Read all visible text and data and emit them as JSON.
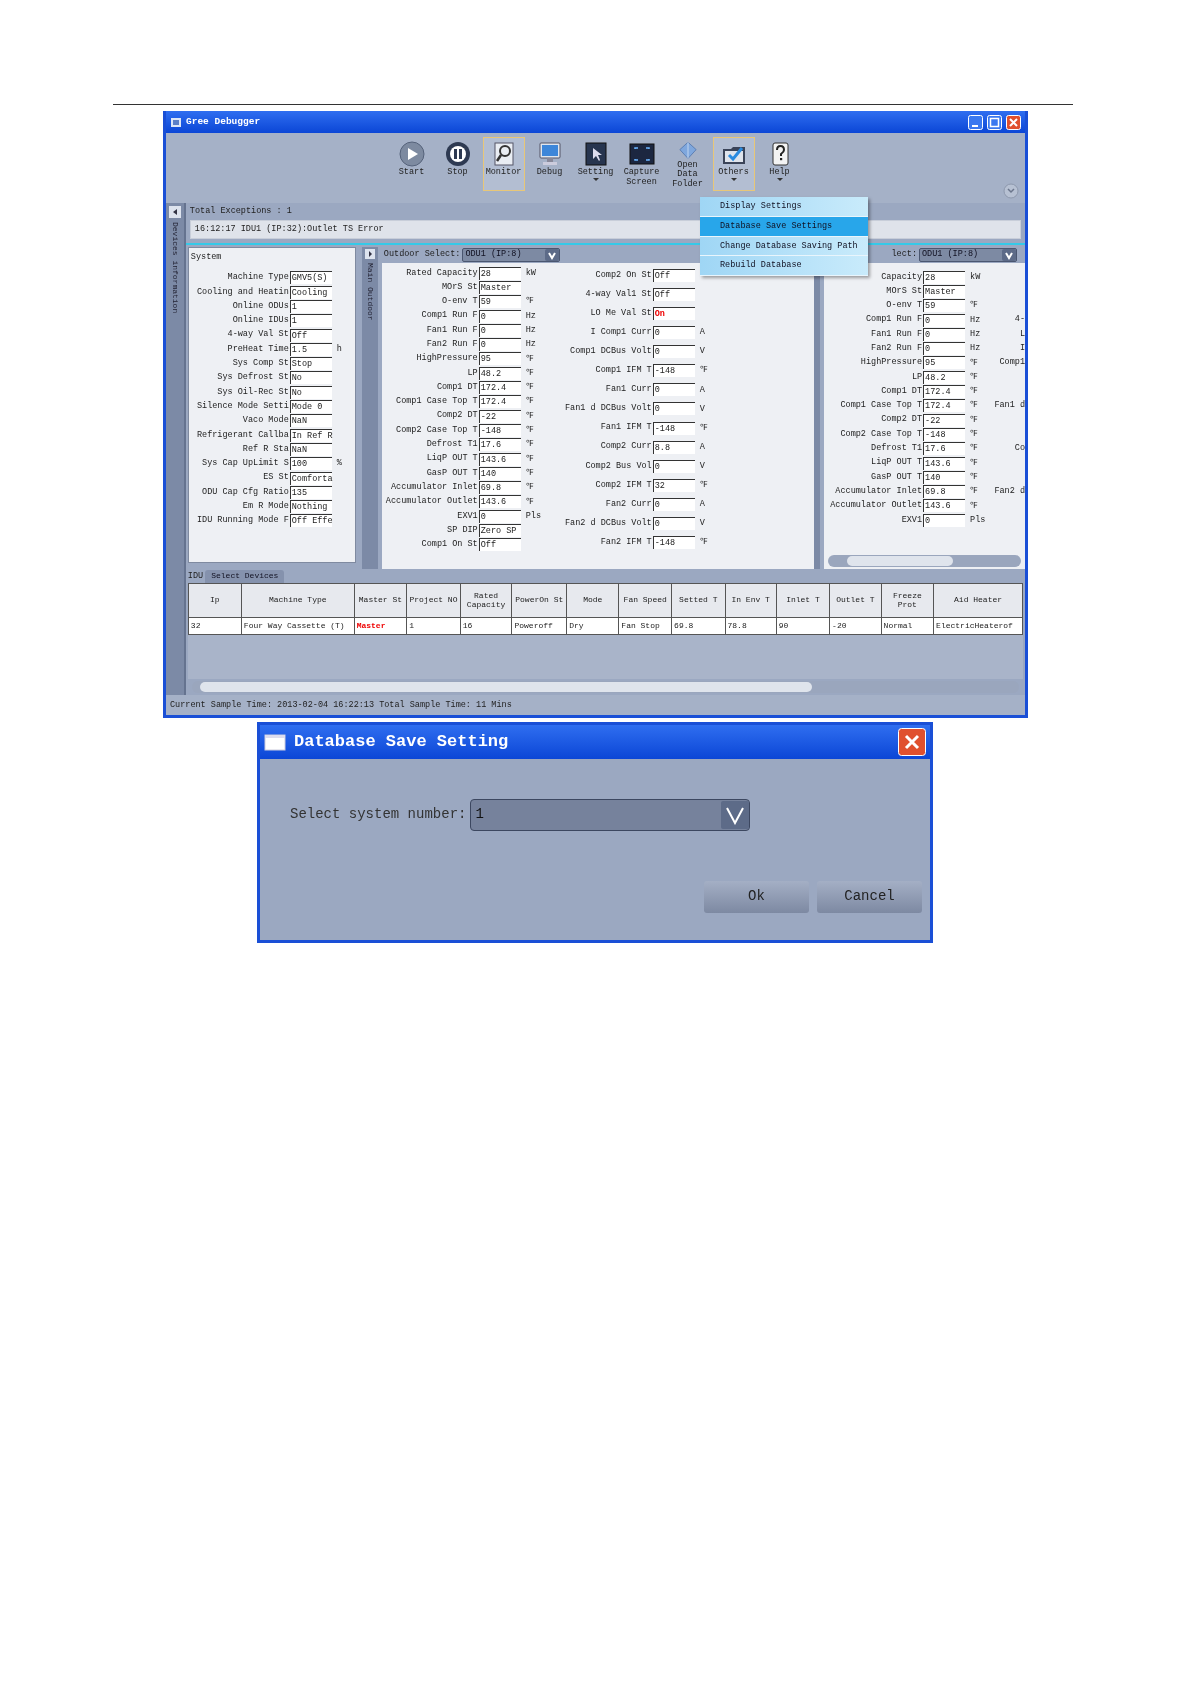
{
  "window": {
    "title": "Gree Debugger"
  },
  "toolbar": [
    {
      "label": "Start",
      "dropdown": false,
      "selected": false
    },
    {
      "label": "Stop",
      "dropdown": false,
      "selected": false
    },
    {
      "label": "Monitor",
      "dropdown": false,
      "selected": true
    },
    {
      "label": "Debug",
      "dropdown": false,
      "selected": false
    },
    {
      "label": "Setting",
      "dropdown": true,
      "selected": false
    },
    {
      "label": "Capture Screen",
      "dropdown": false,
      "selected": false
    },
    {
      "label": "Open Data Folder",
      "dropdown": false,
      "selected": false
    },
    {
      "label": "Others",
      "dropdown": true,
      "selected": true
    },
    {
      "label": "Help",
      "dropdown": true,
      "selected": false
    }
  ],
  "menu": [
    {
      "label": "Display Settings",
      "selected": false
    },
    {
      "label": "Database Save Settings",
      "selected": true
    },
    {
      "label": "Change Database Saving Path",
      "selected": false
    },
    {
      "label": "Rebuild Database",
      "selected": false
    }
  ],
  "side_tab": "Devices information",
  "exceptions": {
    "total": "Total Exceptions : 1",
    "message": "16:12:17 IDU1 (IP:32):Outlet TS Error"
  },
  "system_panel": {
    "title": "System",
    "rows": [
      {
        "label": "Machine Type",
        "value": "GMV5(S)"
      },
      {
        "label": "Cooling and Heatin",
        "value": "Cooling"
      },
      {
        "label": "Online ODUs",
        "value": "1"
      },
      {
        "label": "Online IDUs",
        "value": "1"
      },
      {
        "label": "4-way Val St",
        "value": "Off"
      },
      {
        "label": "PreHeat Time",
        "value": "1.5",
        "unit": "h"
      },
      {
        "label": "Sys Comp St",
        "value": "Stop"
      },
      {
        "label": "Sys Defrost St",
        "value": "No"
      },
      {
        "label": "Sys Oil-Rec St",
        "value": "No"
      },
      {
        "label": "Silence Mode Setti",
        "value": "Mode 0"
      },
      {
        "label": "Vaco Mode",
        "value": "NaN"
      },
      {
        "label": "Refrigerant Callba",
        "value": "In Ref R"
      },
      {
        "label": "Ref R Sta",
        "value": "NaN"
      },
      {
        "label": "Sys Cap UpLimit S",
        "value": "100",
        "unit": "%"
      },
      {
        "label": "ES St",
        "value": "Comforta"
      },
      {
        "label": "ODU Cap Cfg Ratio",
        "value": "135"
      },
      {
        "label": "Em R Mode",
        "value": "Nothing"
      },
      {
        "label": "IDU Running Mode F",
        "value": "Off Effe"
      }
    ]
  },
  "outdoor_panel": {
    "side_tab": "Main Outdoor",
    "select_label": "Outdoor Select:",
    "select_value": "ODU1 (IP:8)",
    "left_rows": [
      {
        "label": "Rated Capacity",
        "value": "28",
        "unit": "kW"
      },
      {
        "label": "MOrS St",
        "value": "Master"
      },
      {
        "label": "O-env T",
        "value": "59",
        "unit": "℉"
      },
      {
        "label": "Comp1 Run F",
        "value": "0",
        "unit": "Hz"
      },
      {
        "label": "Fan1 Run F",
        "value": "0",
        "unit": "Hz"
      },
      {
        "label": "Fan2 Run F",
        "value": "0",
        "unit": "Hz"
      },
      {
        "label": "HighPressure",
        "value": "95",
        "unit": "℉"
      },
      {
        "label": "LP",
        "value": "48.2",
        "unit": "℉"
      },
      {
        "label": "Comp1 DT",
        "value": "172.4",
        "unit": "℉"
      },
      {
        "label": "Comp1 Case Top T",
        "value": "172.4",
        "unit": "℉"
      },
      {
        "label": "Comp2 DT",
        "value": "-22",
        "unit": "℉"
      },
      {
        "label": "Comp2 Case Top T",
        "value": "-148",
        "unit": "℉"
      },
      {
        "label": "Defrost T1",
        "value": "17.6",
        "unit": "℉"
      },
      {
        "label": "LiqP OUT T",
        "value": "143.6",
        "unit": "℉"
      },
      {
        "label": "GasP OUT T",
        "value": "140",
        "unit": "℉"
      },
      {
        "label": "Accumulator Inlet",
        "value": "69.8",
        "unit": "℉"
      },
      {
        "label": "Accumulator Outlet",
        "value": "143.6",
        "unit": "℉"
      },
      {
        "label": "EXV1",
        "value": "0",
        "unit": "Pls"
      },
      {
        "label": "SP DIP",
        "value": "Zero SP"
      },
      {
        "label": "Comp1 On St",
        "value": "Off"
      }
    ],
    "right_rows": [
      {
        "label": "Comp2 On St",
        "value": "Off",
        "alert": false
      },
      {
        "label": "4-way Val1 St",
        "value": "Off",
        "alert": false
      },
      {
        "label": "LO Me Val St",
        "value": "On",
        "alert": true
      },
      {
        "label": "I Comp1 Curr",
        "value": "0",
        "unit": "A",
        "alert": false
      },
      {
        "label": "Comp1 DCBus Volt",
        "value": "0",
        "unit": "V",
        "alert": false
      },
      {
        "label": "Comp1 IFM T",
        "value": "-148",
        "unit": "℉",
        "alert": false
      },
      {
        "label": "Fan1 Curr",
        "value": "0",
        "unit": "A",
        "alert": false
      },
      {
        "label": "Fan1 d DCBus Volt",
        "value": "0",
        "unit": "V",
        "alert": false
      },
      {
        "label": "Fan1 IFM T",
        "value": "-148",
        "unit": "℉",
        "alert": false
      },
      {
        "label": "Comp2 Curr",
        "value": "8.8",
        "unit": "A",
        "alert": false
      },
      {
        "label": "Comp2 Bus Vol",
        "value": "0",
        "unit": "V",
        "alert": false
      },
      {
        "label": "Comp2 IFM T",
        "value": "32",
        "unit": "℉",
        "alert": false
      },
      {
        "label": "Fan2 Curr",
        "value": "0",
        "unit": "A",
        "alert": false
      },
      {
        "label": "Fan2 d DCBus Volt",
        "value": "0",
        "unit": "V",
        "alert": false
      },
      {
        "label": "Fan2 IFM T",
        "value": "-148",
        "unit": "℉",
        "alert": false
      }
    ]
  },
  "second_outdoor_panel": {
    "select_label": "lect:",
    "select_value": "ODU1 (IP:8)",
    "rows": [
      {
        "label": "Capacity",
        "value": "28",
        "unit": "kW"
      },
      {
        "label": "MOrS St",
        "value": "Master"
      },
      {
        "label": "O-env T",
        "value": "59",
        "unit": "℉"
      },
      {
        "label": "Comp1 Run F",
        "value": "0",
        "unit": "Hz",
        "column_2": "4-"
      },
      {
        "label": "Fan1 Run F",
        "value": "0",
        "unit": "Hz",
        "column_2": "L"
      },
      {
        "label": "Fan2 Run F",
        "value": "0",
        "unit": "Hz",
        "column_2": "I"
      },
      {
        "label": "HighPressure",
        "value": "95",
        "unit": "℉",
        "column_2": "Comp1"
      },
      {
        "label": "LP",
        "value": "48.2",
        "unit": "℉"
      },
      {
        "label": "Comp1 DT",
        "value": "172.4",
        "unit": "℉"
      },
      {
        "label": "Comp1 Case Top T",
        "value": "172.4",
        "unit": "℉",
        "column_2": "Fan1 d"
      },
      {
        "label": "Comp2 DT",
        "value": "-22",
        "unit": "℉"
      },
      {
        "label": "Comp2 Case Top T",
        "value": "-148",
        "unit": "℉"
      },
      {
        "label": "Defrost T1",
        "value": "17.6",
        "unit": "℉",
        "column_2": "Co"
      },
      {
        "label": "LiqP OUT T",
        "value": "143.6",
        "unit": "℉"
      },
      {
        "label": "GasP OUT T",
        "value": "140",
        "unit": "℉"
      },
      {
        "label": "Accumulator Inlet",
        "value": "69.8",
        "unit": "℉",
        "column_2": "Fan2 d"
      },
      {
        "label": "Accumulator Outlet",
        "value": "143.6",
        "unit": "℉"
      },
      {
        "label": "EXV1",
        "value": "0",
        "unit": "Pls"
      }
    ]
  },
  "idu_section": {
    "label": "IDU",
    "tab": "Select Devices",
    "table": {
      "columns": [
        "Ip",
        "Machine Type",
        "Master St",
        "Project NO",
        "Rated Capacity",
        "PowerOn St",
        "Mode",
        "Fan Speed",
        "Setted T",
        "In Env T",
        "Inlet T",
        "Outlet T",
        "Freeze Prot",
        "Aid Heater"
      ],
      "rows": [
        {
          "cells": [
            {
              "text": "32",
              "alert": false
            },
            {
              "text": "Four Way Cassette (T)",
              "alert": false
            },
            {
              "text": "Master",
              "alert": true
            },
            {
              "text": "1",
              "alert": false
            },
            {
              "text": "16",
              "alert": false
            },
            {
              "text": "Poweroff",
              "alert": false
            },
            {
              "text": "Dry",
              "alert": false
            },
            {
              "text": "Fan Stop",
              "alert": false
            },
            {
              "text": "69.8",
              "alert": false
            },
            {
              "text": "78.8",
              "alert": false
            },
            {
              "text": "90",
              "alert": false
            },
            {
              "text": "-20",
              "alert": false
            },
            {
              "text": "Normal",
              "alert": false
            },
            {
              "text": "ElectricHeaterof",
              "alert": false
            }
          ]
        }
      ]
    }
  },
  "status_bar": "Current Sample Time: 2013-02-04 16:22:13  Total Sample Time: 11 Mins",
  "dialog": {
    "title": "Database Save Setting",
    "label": "Select system number:",
    "value": "1",
    "buttons": [
      "Ok",
      "Cancel"
    ]
  }
}
